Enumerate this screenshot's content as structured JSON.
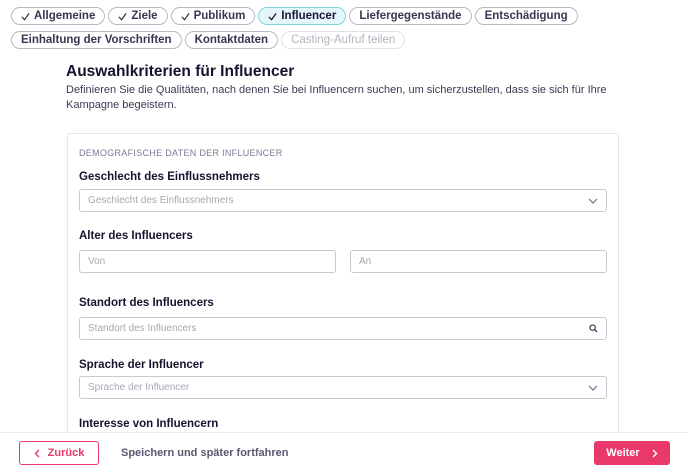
{
  "tabs_row1": [
    {
      "label": "Allgemeine",
      "checked": true
    },
    {
      "label": "Ziele",
      "checked": true
    },
    {
      "label": "Publikum",
      "checked": true
    },
    {
      "label": "Influencer",
      "checked": true,
      "active": true
    },
    {
      "label": "Liefergegenstände",
      "checked": false
    },
    {
      "label": "Entschädigung",
      "checked": false
    }
  ],
  "tabs_row2": [
    {
      "label": "Einhaltung der Vorschriften"
    },
    {
      "label": "Kontaktdaten"
    },
    {
      "label": "Casting-Aufruf teilen",
      "disabled": true
    }
  ],
  "section": {
    "title": "Auswahlkriterien für Influencer",
    "description": "Definieren Sie die Qualitäten, nach denen Sie bei Influencern suchen, um sicherzustellen, dass sie sich für Ihre Kampagne begeistern."
  },
  "card": {
    "caption": "DEMOGRAFISCHE DATEN DER INFLUENCER",
    "gender": {
      "label": "Geschlecht des Einflussnehmers",
      "placeholder": "Geschlecht des Einflussnehmers"
    },
    "age": {
      "label": "Alter des Influencers",
      "from_placeholder": "Von",
      "to_placeholder": "An"
    },
    "location": {
      "label": "Standort des Influencers",
      "placeholder": "Standort des Influencers"
    },
    "language": {
      "label": "Sprache der Influencer",
      "placeholder": "Sprache der Influencer"
    },
    "interests": {
      "label": "Interesse von Influencern"
    }
  },
  "footer": {
    "back_label": "Zurück",
    "save_label": "Speichern und später fortfahren",
    "next_label": "Weiter"
  },
  "colors": {
    "accent": "#e8396a",
    "active_tab_bg": "#e3f7fb",
    "active_tab_border": "#7fd4e4"
  }
}
